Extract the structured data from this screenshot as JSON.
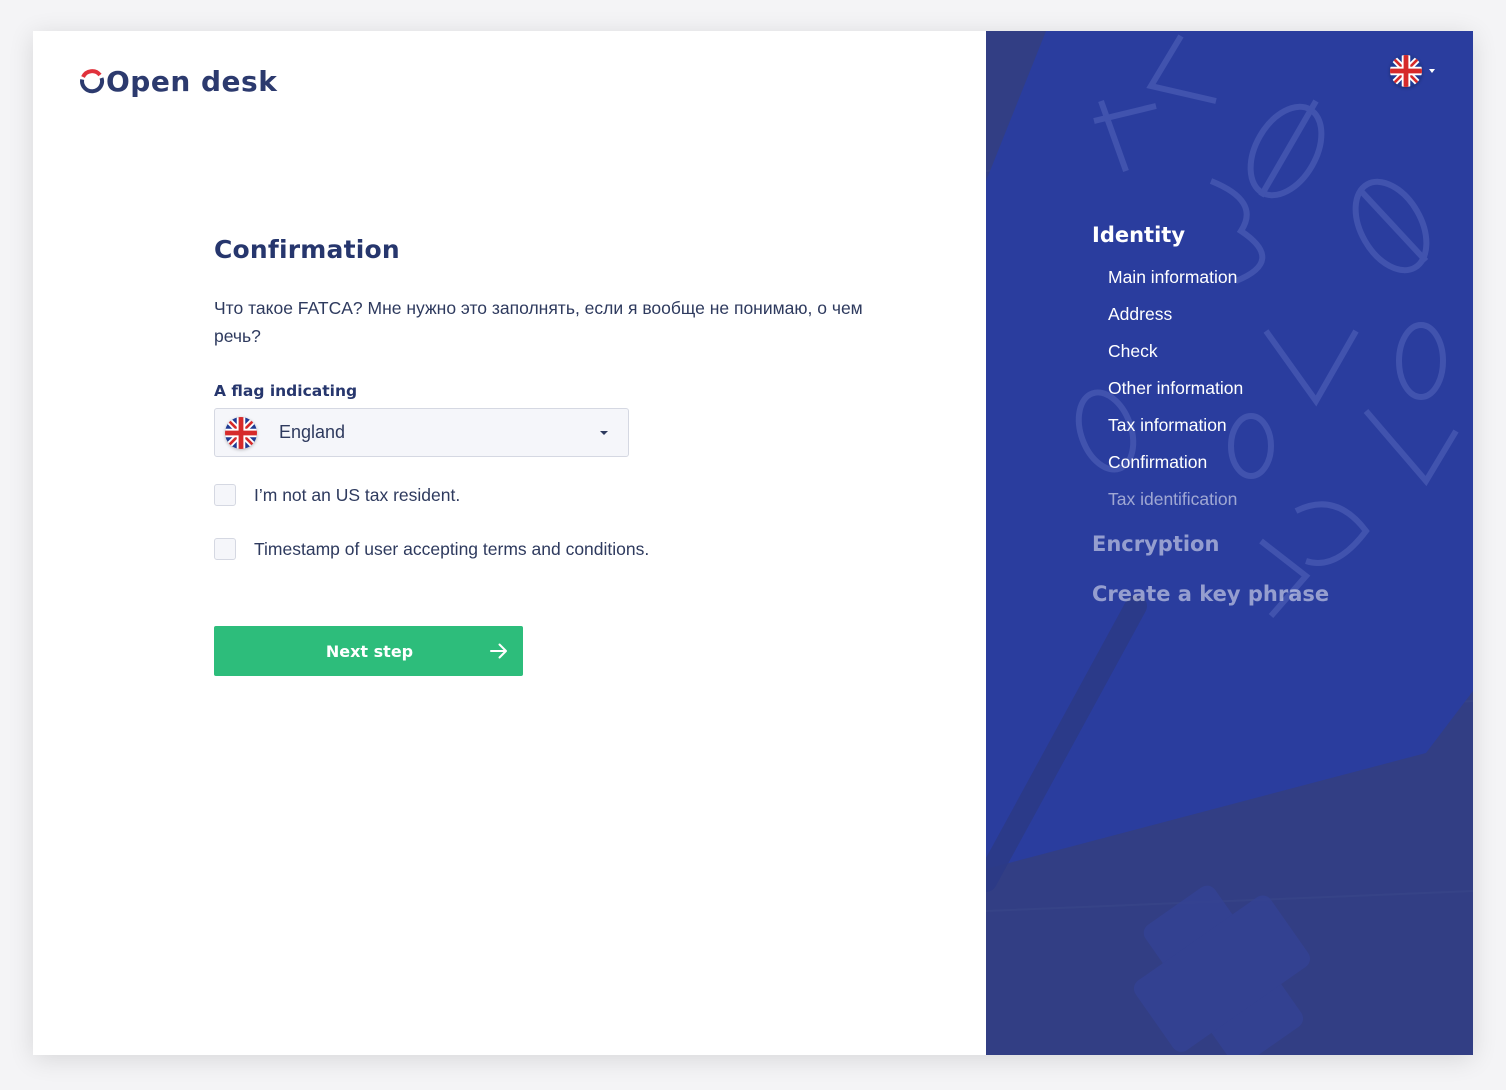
{
  "brand": {
    "name": "Open desk",
    "accent": "#e0323c",
    "primary": "#26366d"
  },
  "form": {
    "title": "Confirmation",
    "description": "Что такое FATCA? Мне нужно это заполнять, если я вообще не понимаю, о чем речь?",
    "flag_field": {
      "label": "A flag indicating",
      "value": "England",
      "icon": "uk-flag-icon"
    },
    "checkboxes": [
      {
        "label": "I’m not an US tax resident.",
        "checked": false
      },
      {
        "label": "Timestamp of user accepting terms and conditions.",
        "checked": false
      }
    ],
    "next_button": {
      "label": "Next step",
      "color": "#2dbd7b",
      "icon": "arrow-right-icon"
    }
  },
  "sidebar": {
    "background": "#323e84",
    "language_selector": {
      "icon": "uk-flag-icon"
    },
    "steps": [
      {
        "title": "Identity",
        "active": true,
        "items": [
          {
            "label": "Main information",
            "state": "done"
          },
          {
            "label": "Address",
            "state": "done"
          },
          {
            "label": "Check",
            "state": "done"
          },
          {
            "label": "Other  information",
            "state": "done"
          },
          {
            "label": "Tax information",
            "state": "done"
          },
          {
            "label": "Confirmation",
            "state": "current"
          },
          {
            "label": "Tax identification",
            "state": "pending"
          }
        ]
      },
      {
        "title": "Encryption",
        "active": false
      },
      {
        "title": "Create a key phrase",
        "active": false
      }
    ]
  }
}
